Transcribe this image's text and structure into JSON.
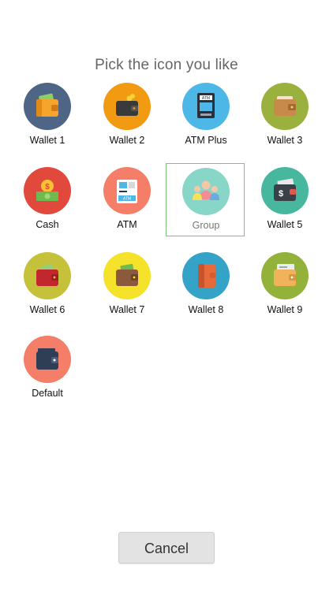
{
  "dialog": {
    "title": "Pick the icon you like",
    "cancel_label": "Cancel"
  },
  "icons": [
    {
      "label": "Wallet 1",
      "icon": "wallet-icon",
      "bg": "#4f6586"
    },
    {
      "label": "Wallet 2",
      "icon": "wallet-icon",
      "bg": "#f29a12"
    },
    {
      "label": "ATM Plus",
      "icon": "atm-machine-icon",
      "bg": "#4db7e8"
    },
    {
      "label": "Wallet 3",
      "icon": "wallet-icon",
      "bg": "#9bb13d"
    },
    {
      "label": "Cash",
      "icon": "cash-icon",
      "bg": "#e0493c"
    },
    {
      "label": "ATM",
      "icon": "atm-icon",
      "bg": "#f47e68"
    },
    {
      "label": "Group",
      "icon": "group-icon",
      "bg": "#88d6c7",
      "selected": true
    },
    {
      "label": "Wallet 5",
      "icon": "wallet-dollar-icon",
      "bg": "#47b89e"
    },
    {
      "label": "Wallet 6",
      "icon": "wallet-icon",
      "bg": "#c6c13a"
    },
    {
      "label": "Wallet 7",
      "icon": "wallet-icon",
      "bg": "#f5e22a"
    },
    {
      "label": "Wallet 8",
      "icon": "wallet-icon",
      "bg": "#35a3c7"
    },
    {
      "label": "Wallet 9",
      "icon": "wallet-icon",
      "bg": "#93b23a"
    },
    {
      "label": "Default",
      "icon": "wallet-icon",
      "bg": "#f47e68"
    }
  ]
}
